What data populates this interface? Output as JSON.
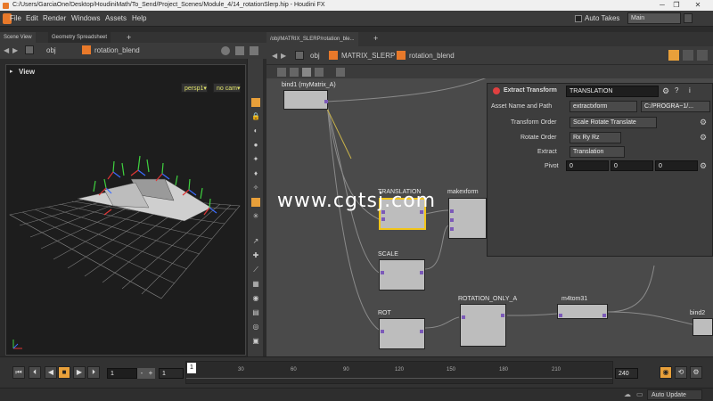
{
  "window": {
    "title": "C:/Users/GarciaOne/Desktop/HoudiniMath/To_Send/Project_Scenes/Module_4/14_rotationSlerp.hip - Houdini FX",
    "controls": [
      "─",
      "❐",
      "✕"
    ]
  },
  "menu": {
    "items": [
      "File",
      "Edit",
      "Render",
      "Windows",
      "Assets",
      "Help"
    ],
    "auto_takes_label": "Auto Takes",
    "desktop": "Main"
  },
  "left_pane": {
    "tabs": [
      "Scene View",
      "Geometry Spreadsheet"
    ],
    "add_tab": "+",
    "path": [
      "obj",
      "rotation_blend"
    ],
    "view_title": "View",
    "camera_menu": "persp1▾",
    "cam_menu": "no cam▾"
  },
  "network_pane": {
    "tab": "/obj/MATRIX_SLERP/rotation_ble...",
    "add_tab": "+",
    "path": [
      "obj",
      "MATRIX_SLERP",
      "rotation_blend"
    ]
  },
  "nodes": {
    "bind1": "bind1 (myMatrix_A)",
    "translation": "TRANSLATION",
    "makexform": "makexform",
    "scale": "SCALE",
    "rot": "ROT",
    "rotation_only_a": "ROTATION_ONLY_A",
    "m4tom31": "m4tom31",
    "bind2": "bind2"
  },
  "params": {
    "node_type": "Extract Transform",
    "node_name": "TRANSLATION",
    "asset_label": "Asset Name and Path",
    "asset_value": "extractxform",
    "asset_path": "C:/PROGRA~1/...",
    "transform_order_label": "Transform Order",
    "transform_order_value": "Scale Rotate Translate",
    "rotate_order_label": "Rotate Order",
    "rotate_order_value": "Rx Ry Rz",
    "extract_label": "Extract",
    "extract_value": "Translation",
    "pivot_label": "Pivot",
    "pivot": [
      "0",
      "0",
      "0"
    ]
  },
  "timeline": {
    "start": "1",
    "start2": "1",
    "current": "1",
    "end": "240",
    "ticks": [
      "30",
      "60",
      "90",
      "120",
      "150",
      "180",
      "210"
    ],
    "marker": "1"
  },
  "status": {
    "update_mode": "Auto Update"
  },
  "watermark": "www.cgtsj.com",
  "colors": {
    "houdini_orange": "#e8792a",
    "node_grey": "#bdbdbd",
    "selected_node": "#f2c51a",
    "param_bg": "#3d3d3d"
  }
}
